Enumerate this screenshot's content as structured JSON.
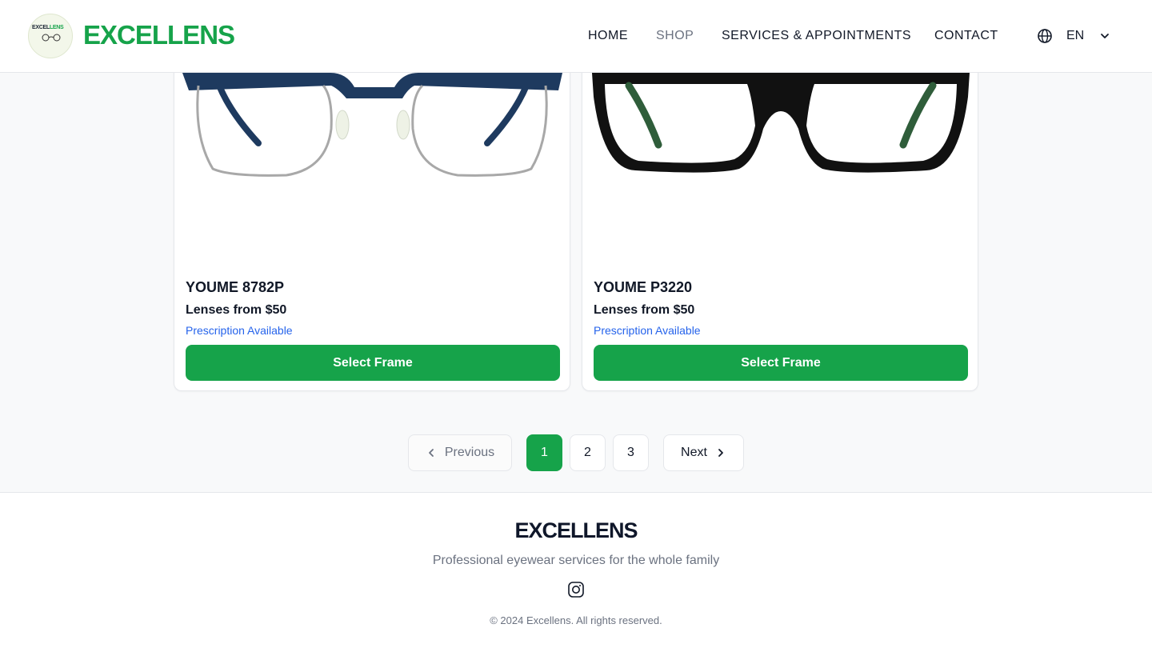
{
  "header": {
    "logo_text": "EXCELLENS",
    "brand": "EXCELLENS",
    "nav": [
      "HOME",
      "SHOP",
      "SERVICES & APPOINTMENTS",
      "CONTACT"
    ],
    "active_nav": "SHOP",
    "language": "EN",
    "icons": {
      "language": "globe-icon",
      "dropdown": "chevron-down-icon"
    }
  },
  "products": [
    {
      "name": "YOUME 8782P",
      "price": "Lenses from $50",
      "note": "Prescription Available",
      "button": "Select Frame"
    },
    {
      "name": "YOUME P3220",
      "price": "Lenses from $50",
      "note": "Prescription Available",
      "button": "Select Frame"
    }
  ],
  "pagination": {
    "previous": "Previous",
    "pages": [
      "1",
      "2",
      "3"
    ],
    "current": "1",
    "next": "Next"
  },
  "footer": {
    "brand": "EXCELLENS",
    "tagline": "Professional eyewear services for the whole family",
    "social_icon": "instagram-icon",
    "copyright": "© 2024 Excellens. All rights reserved."
  },
  "colors": {
    "primary": "#16a34a",
    "link": "#2563eb",
    "text": "#111827",
    "muted": "#6b7280",
    "background": "#f8f9fa"
  }
}
